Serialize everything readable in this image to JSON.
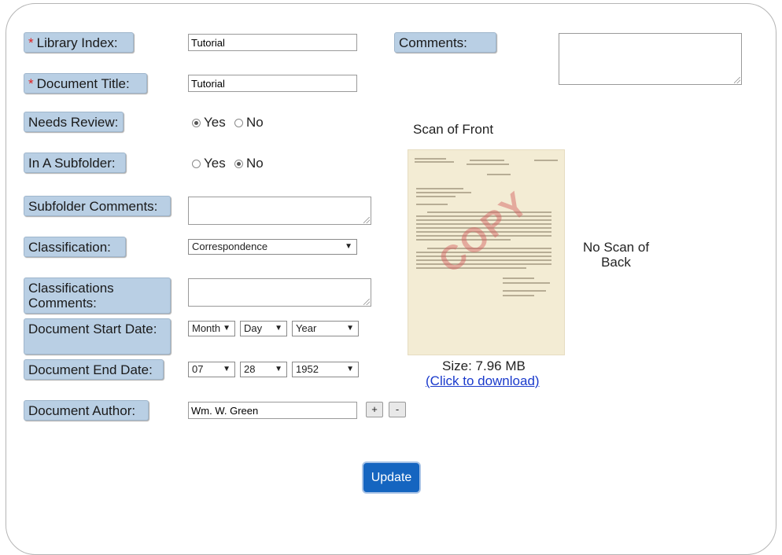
{
  "labels": {
    "library_index": "Library Index:",
    "document_title": "Document Title:",
    "needs_review": "Needs Review:",
    "in_subfolder": "In A Subfolder:",
    "subfolder_comments": "Subfolder Comments:",
    "classification": "Classification:",
    "classification_comments": "Classifications Comments:",
    "start_date": "Document Start Date:",
    "end_date": "Document End Date:",
    "author": "Document Author:",
    "comments": "Comments:"
  },
  "required_mark": "*",
  "values": {
    "library_index": "Tutorial",
    "document_title": "Tutorial",
    "classification": "Correspondence",
    "start_month": "Month",
    "start_day": "Day",
    "start_year": "Year",
    "end_month": "07",
    "end_day": "28",
    "end_year": "1952",
    "author": "Wm. W. Green"
  },
  "radio": {
    "yes": "Yes",
    "no": "No",
    "needs_review_selected": "Yes",
    "in_subfolder_selected": "No"
  },
  "scan": {
    "front_title": "Scan of Front",
    "back_text": "No Scan of Back",
    "size": "Size: 7.96 MB",
    "download_link": "(Click to download)",
    "stamp_text": "COPY"
  },
  "buttons": {
    "add": "+",
    "remove": "-",
    "update": "Update"
  }
}
